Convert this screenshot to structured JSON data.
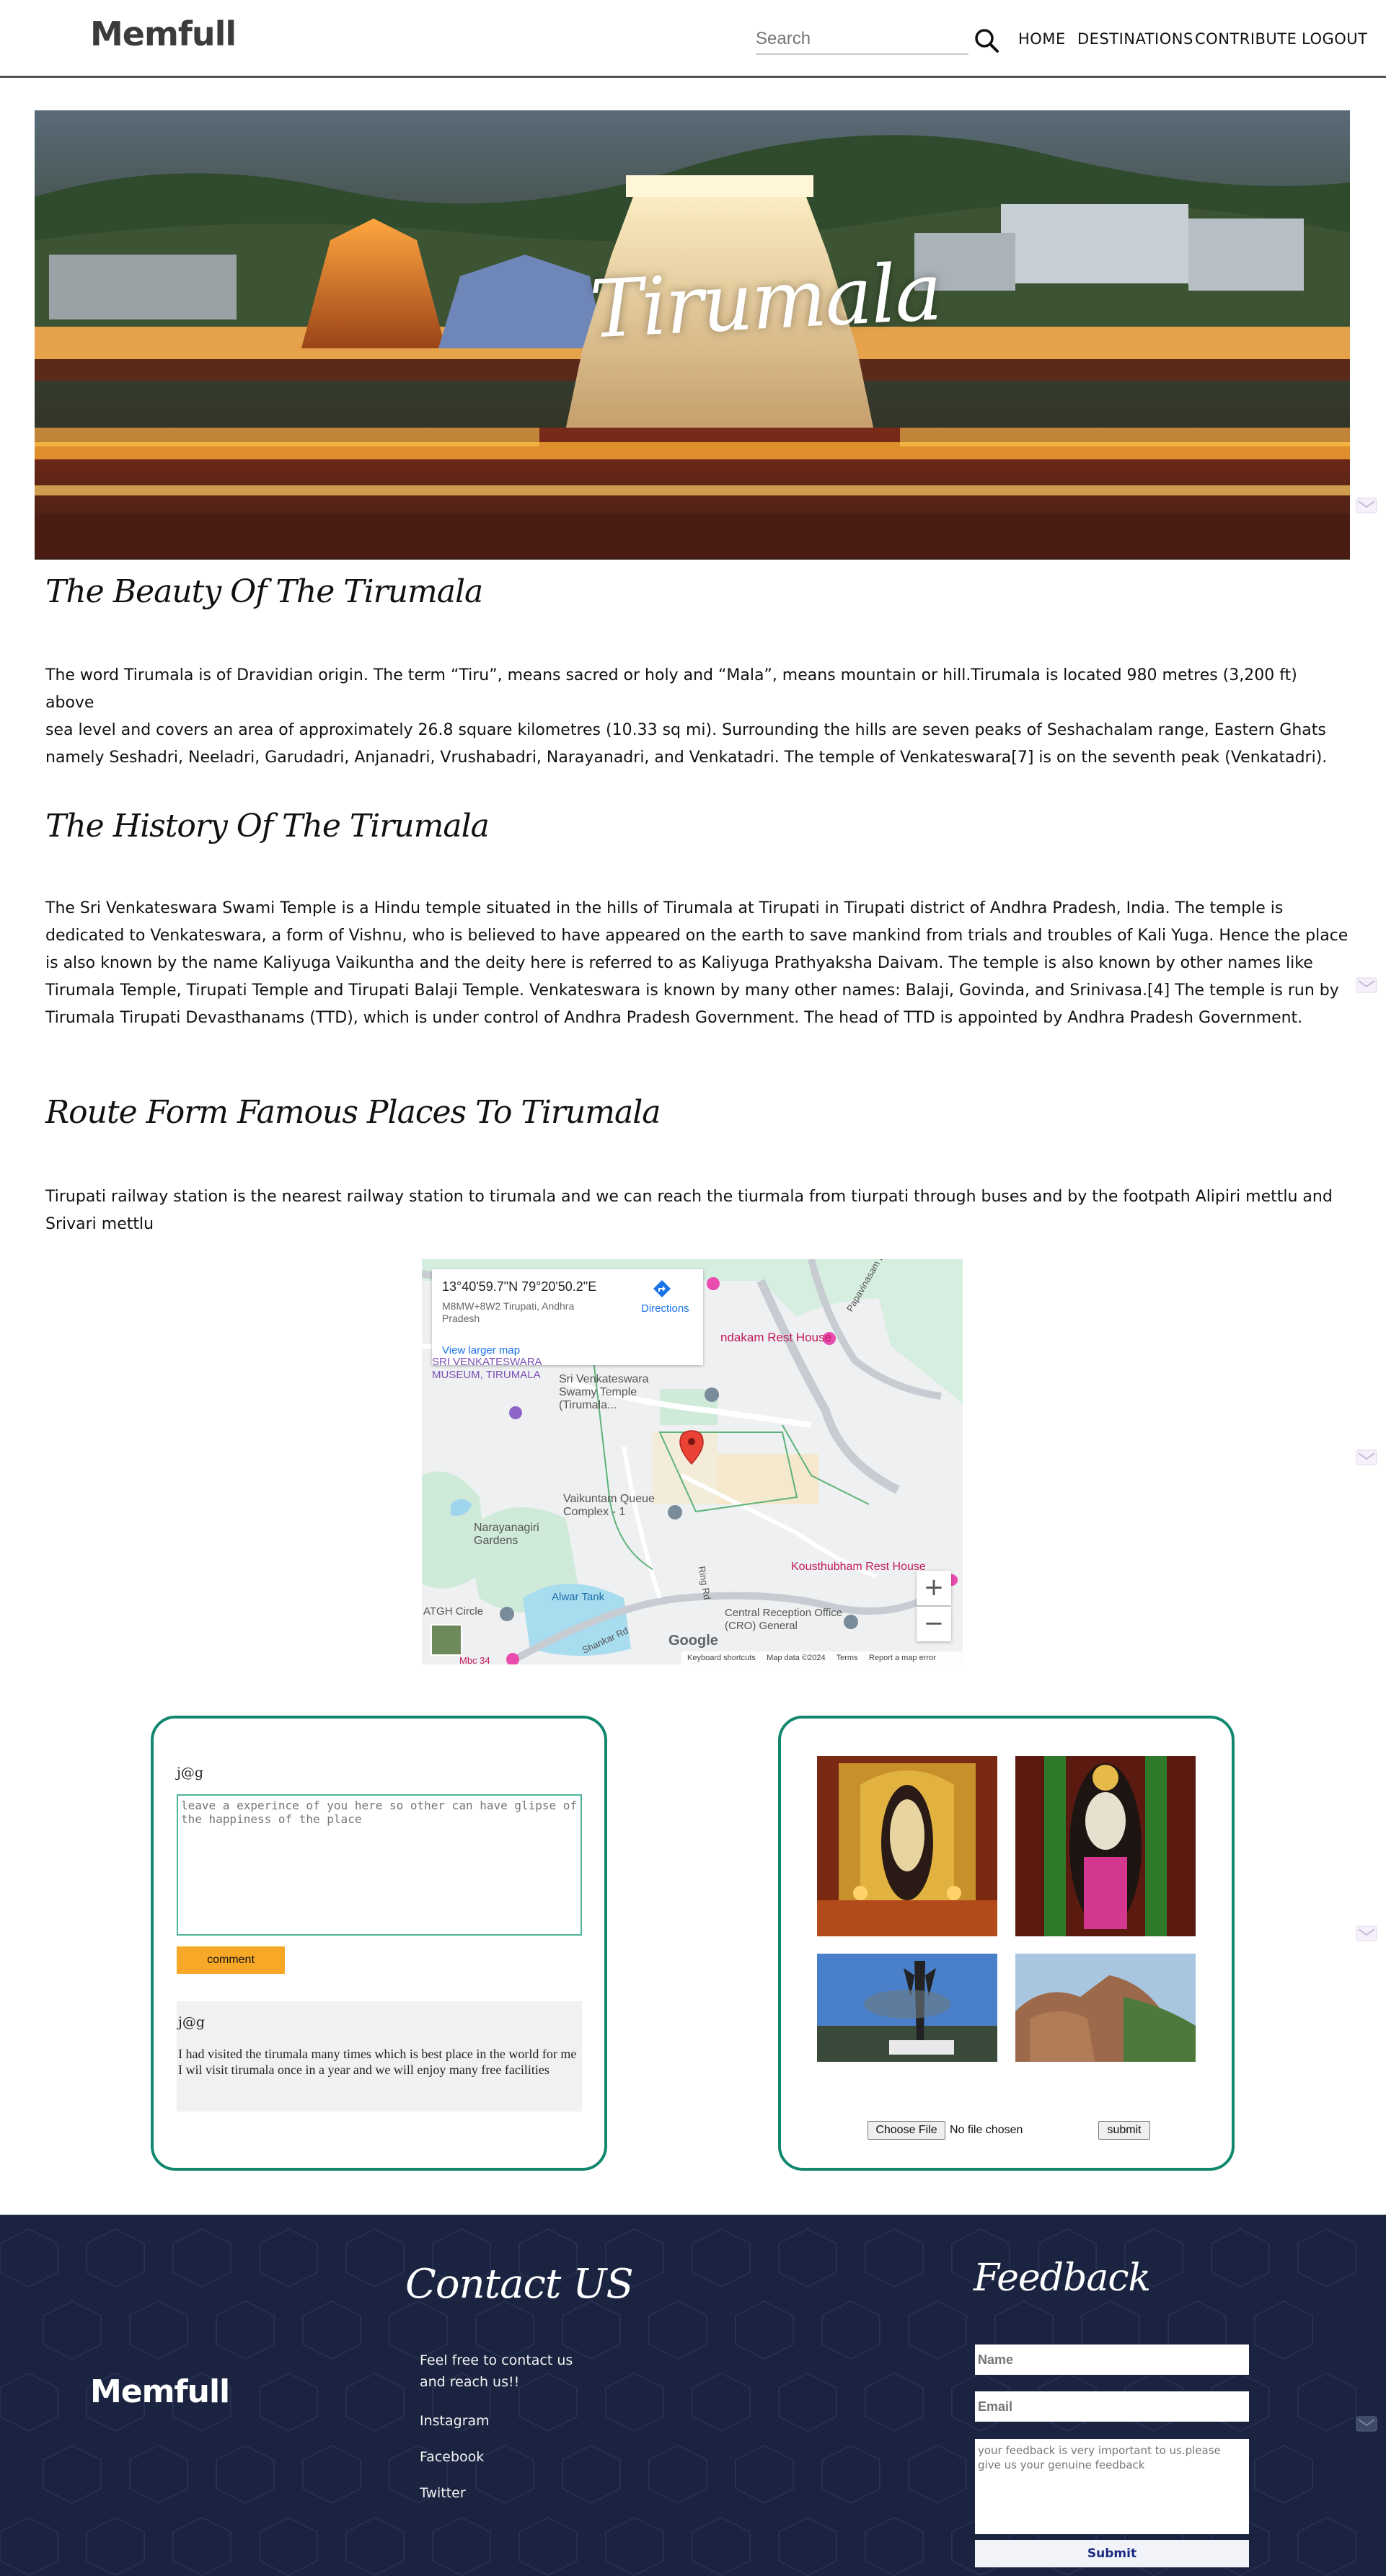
{
  "header": {
    "logo": "Memfull",
    "search_placeholder": "Search",
    "nav": [
      "HOME",
      "DESTINATIONS",
      "CONTRIBUTE",
      "LOGOUT"
    ]
  },
  "hero": {
    "title": "Tirumala"
  },
  "sections": [
    {
      "title": "The Beauty Of The Tirumala",
      "lines": [
        "The word Tirumala is of Dravidian origin. The term “Tiru”, means sacred or holy and “Mala”, means mountain or hill.Tirumala is located 980 metres (3,200 ft) above",
        "sea level and covers an area of approximately 26.8 square kilometres (10.33 sq mi). Surrounding the hills are seven peaks of Seshachalam range, Eastern Ghats",
        "namely Seshadri, Neeladri, Garudadri, Anjanadri, Vrushabadri, Narayanadri, and Venkatadri. The temple of Venkateswara[7] is on the seventh peak (Venkatadri)."
      ]
    },
    {
      "title": "The History Of The Tirumala",
      "lines": [
        "The Sri Venkateswara Swami Temple is a Hindu temple situated in the hills of Tirumala at Tirupati in Tirupati district of Andhra Pradesh, India. The temple is",
        "dedicated to Venkateswara, a form of Vishnu, who is believed to have appeared on the earth to save mankind from trials and troubles of Kali Yuga. Hence the place",
        "is also known by the name Kaliyuga Vaikuntha and the deity here is referred to as Kaliyuga Prathyaksha Daivam. The temple is also known by other names like",
        "Tirumala Temple, Tirupati Temple and Tirupati Balaji Temple. Venkateswara is known by many other names: Balaji, Govinda, and Srinivasa.[4] The temple is run by",
        "Tirumala Tirupati Devasthanams (TTD), which is under control of Andhra Pradesh Government. The head of TTD is appointed by Andhra Pradesh Government."
      ]
    },
    {
      "title": "Route Form Famous Places To Tirumala",
      "lines": [
        "Tirupati railway station is the nearest railway station to tirumala and we can reach the tiurmala from tiurpati through buses and by the footpath Alipiri mettlu and",
        "Srivari mettlu"
      ]
    }
  ],
  "map": {
    "coords": "13°40'59.7\"N 79°20'50.2\"E",
    "address": "M8MW+8W2 Tirupati, Andhra Pradesh",
    "larger_map": "View larger map",
    "directions": "Directions",
    "labels": {
      "rest_house": "ndakam Rest House",
      "museum": "SRI VENKATESWARA MUSEUM, TIRUMALA",
      "temple": "Sri Venkateswara Swamy Temple (Tirumala...",
      "vaikuntam": "Vaikuntam Queue Complex - 1",
      "gardens": "Narayanagiri Gardens",
      "kousthubham": "Kousthubham Rest House",
      "alwar": "Alwar Tank",
      "central": "Central Reception Office (CRO) General",
      "atgh": "ATGH Circle",
      "papavinasam": "Papavinasam Rd",
      "ring_rd": "Ring Rd",
      "shankar": "Shankar Rd",
      "mbc": "Mbc 34"
    },
    "google": "Google",
    "footer": [
      "Keyboard shortcuts",
      "Map data ©2024",
      "Terms",
      "Report a map error"
    ]
  },
  "comments": {
    "user": "j@g",
    "placeholder": "leave a experince of you here so other can have glipse of the happiness of the place",
    "button": "comment",
    "card": {
      "user": "j@g",
      "text": "I had visited the tirumala many times which is best place in the world for me I wil visit tirumala once in a year and we will enjoy many free facilities"
    }
  },
  "upload": {
    "choose": "Choose File",
    "status": "No file chosen",
    "submit": "submit"
  },
  "footer": {
    "logo": "Memfull",
    "contact_title": "Contact US",
    "contact_lines": [
      "Feel free to contact us",
      "and reach us!!"
    ],
    "links": [
      "Instagram",
      "Facebook",
      "Twitter"
    ],
    "feedback_title": "Feedback",
    "name_placeholder": "Name",
    "email_placeholder": "Email",
    "feedback_placeholder": "your feedback is very important to us.please give us your genuine feedback",
    "submit": "Submit"
  },
  "colors": {
    "accent_green": "#12876f",
    "comment_button": "#f7a826",
    "footer_bg": "#1a2340"
  }
}
